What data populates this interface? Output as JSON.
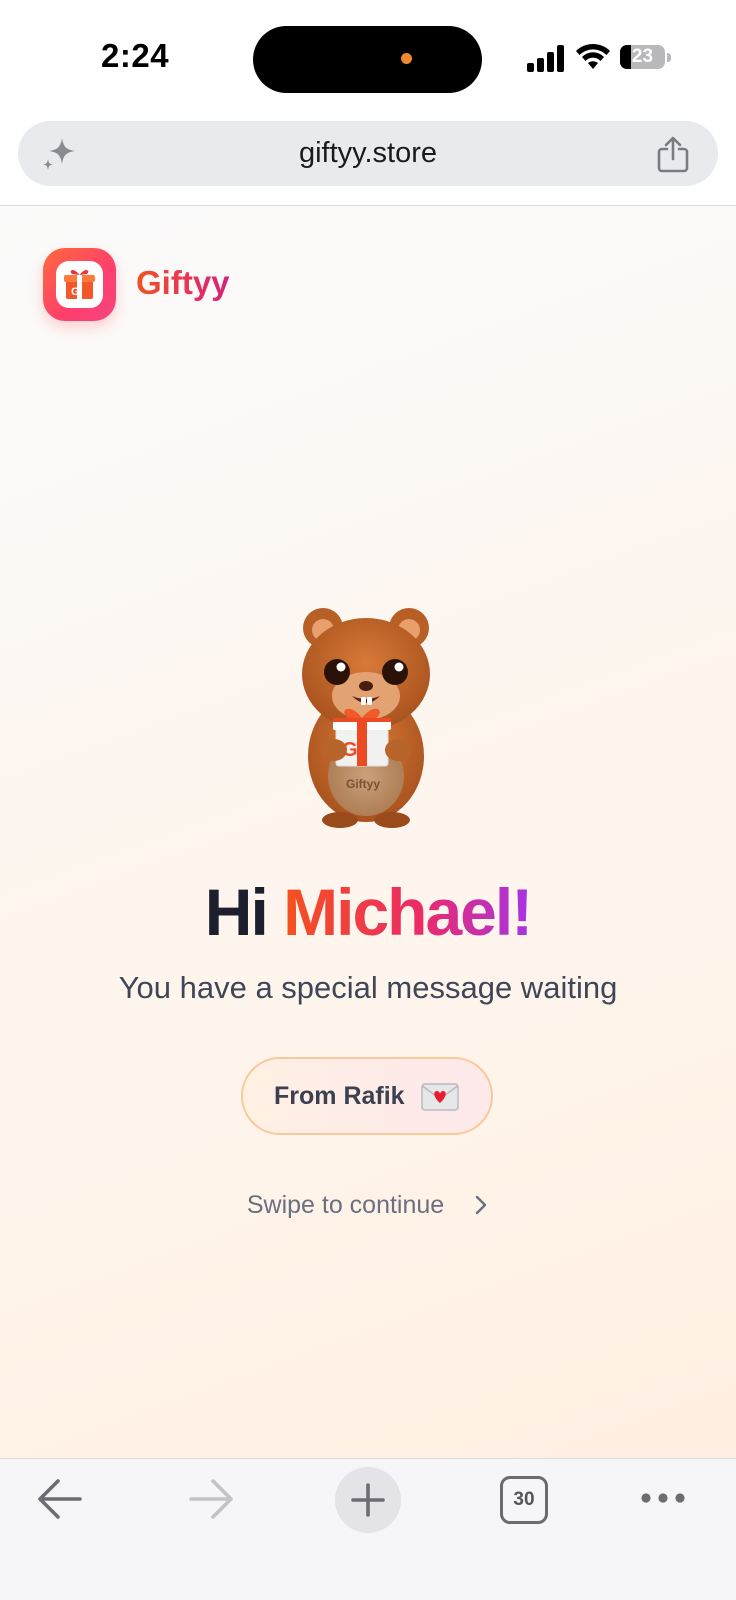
{
  "status_bar": {
    "time": "2:24",
    "battery_level": "23"
  },
  "url_bar": {
    "url": "giftyy.store"
  },
  "brand": {
    "name": "Giftyy",
    "logo_icon": "gift-box-icon"
  },
  "hero": {
    "mascot": "squirrel-holding-gift-mascot",
    "greeting_prefix": "Hi",
    "greeting_name": "Michael!",
    "subtitle": "You have a special message waiting",
    "from_label": "From Rafik",
    "from_icon": "love-letter-envelope-icon",
    "swipe_label": "Swipe to continue"
  },
  "toolbar": {
    "back_icon": "back-arrow-icon",
    "forward_icon": "forward-arrow-icon",
    "new_tab_icon": "plus-icon",
    "tab_count": "30",
    "more_icon": "more-dots-icon"
  },
  "colors": {
    "accent_orange": "#f4521d",
    "accent_pink": "#ec2b67",
    "accent_purple": "#a733e6",
    "pill_border": "#f7c99b"
  }
}
